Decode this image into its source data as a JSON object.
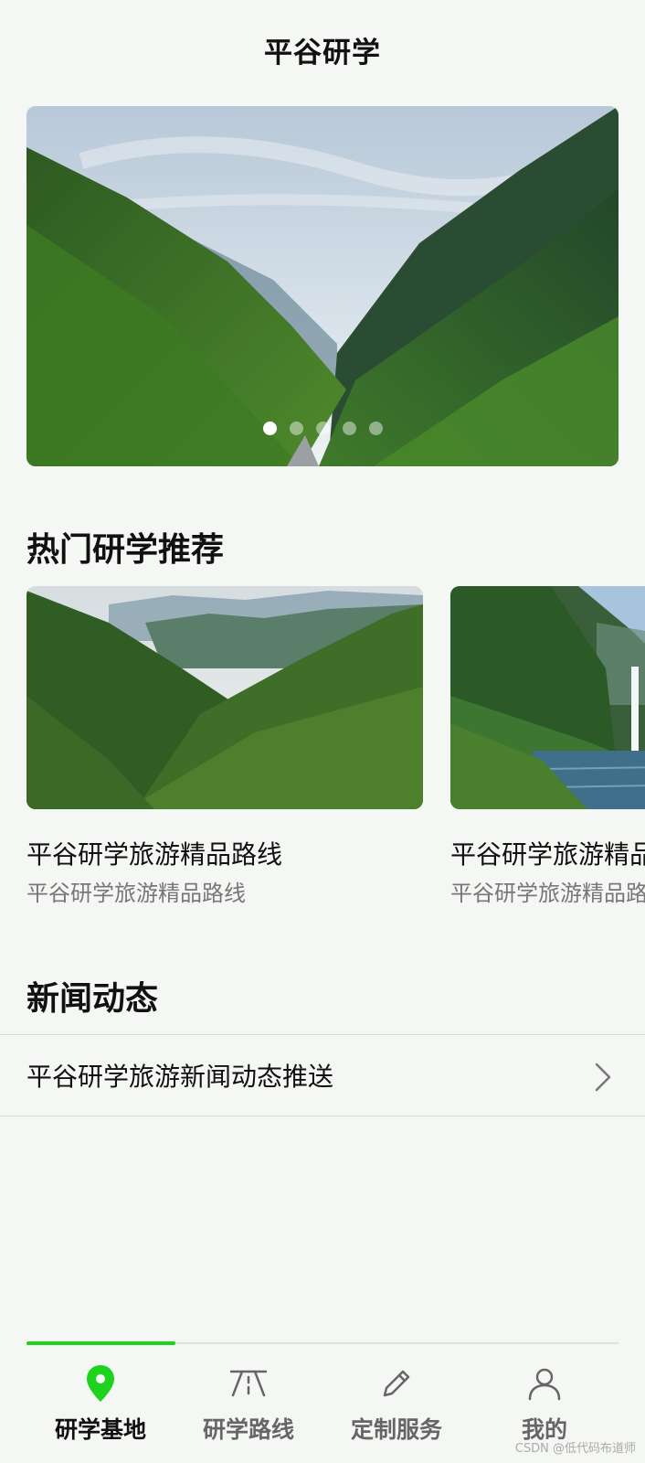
{
  "header": {
    "title": "平谷研学"
  },
  "banner": {
    "dot_count": 5,
    "active_index": 0
  },
  "hot": {
    "section_title": "热门研学推荐",
    "cards": [
      {
        "title": "平谷研学旅游精品路线",
        "subtitle": "平谷研学旅游精品路线"
      },
      {
        "title": "平谷研学旅游精品路线",
        "subtitle": "平谷研学旅游精品路线"
      }
    ]
  },
  "news": {
    "section_title": "新闻动态",
    "items": [
      {
        "text": "平谷研学旅游新闻动态推送"
      }
    ]
  },
  "tabbar": {
    "active_color": "#1ed31e",
    "tabs": [
      {
        "label": "研学基地",
        "icon": "location-pin-icon",
        "active": true
      },
      {
        "label": "研学路线",
        "icon": "road-icon",
        "active": false
      },
      {
        "label": "定制服务",
        "icon": "pencil-icon",
        "active": false
      },
      {
        "label": "我的",
        "icon": "user-icon",
        "active": false
      }
    ]
  },
  "watermark": "CSDN @低代码布道师"
}
